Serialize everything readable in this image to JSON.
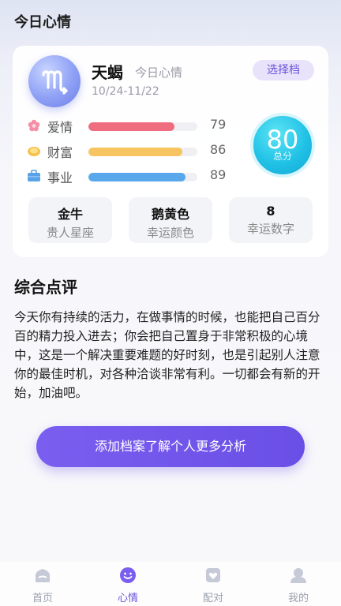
{
  "header": {
    "title": "今日心情"
  },
  "sign": {
    "name": "天蝎",
    "subtitle": "今日心情",
    "date_range": "10/24-11/22",
    "select_label": "选择档"
  },
  "stats": [
    {
      "label": "爱情",
      "value": "79",
      "percent": 79,
      "color": "#f06d7f",
      "icon": "flower-icon"
    },
    {
      "label": "财富",
      "value": "86",
      "percent": 86,
      "color": "#f6c561",
      "icon": "coin-icon"
    },
    {
      "label": "事业",
      "value": "89",
      "percent": 89,
      "color": "#5aa8ec",
      "icon": "briefcase-icon"
    }
  ],
  "score": {
    "value": "80",
    "unit": "总分"
  },
  "info": [
    {
      "value": "金牛",
      "label": "贵人星座"
    },
    {
      "value": "鹅黄色",
      "label": "幸运颜色"
    },
    {
      "value": "8",
      "label": "幸运数字"
    }
  ],
  "review": {
    "title": "综合点评",
    "text": " 今天你有持续的活力，在做事情的时候，也能把自己百分百的精力投入进去；你会把自己置身于非常积极的心境中，这是一个解决重要难题的好时刻，也是引起别人注意你的最佳时机，对各种洽谈非常有利。一切都会有新的开始，加油吧。"
  },
  "cta": {
    "label": "添加档案了解个人更多分析"
  },
  "tabs": [
    {
      "label": "首页",
      "icon": "home-icon"
    },
    {
      "label": "心情",
      "icon": "mood-icon",
      "active": true
    },
    {
      "label": "配对",
      "icon": "match-icon"
    },
    {
      "label": "我的",
      "icon": "profile-icon"
    }
  ],
  "colors": {
    "accent": "#6b55d8",
    "score": "#21c2e6"
  }
}
